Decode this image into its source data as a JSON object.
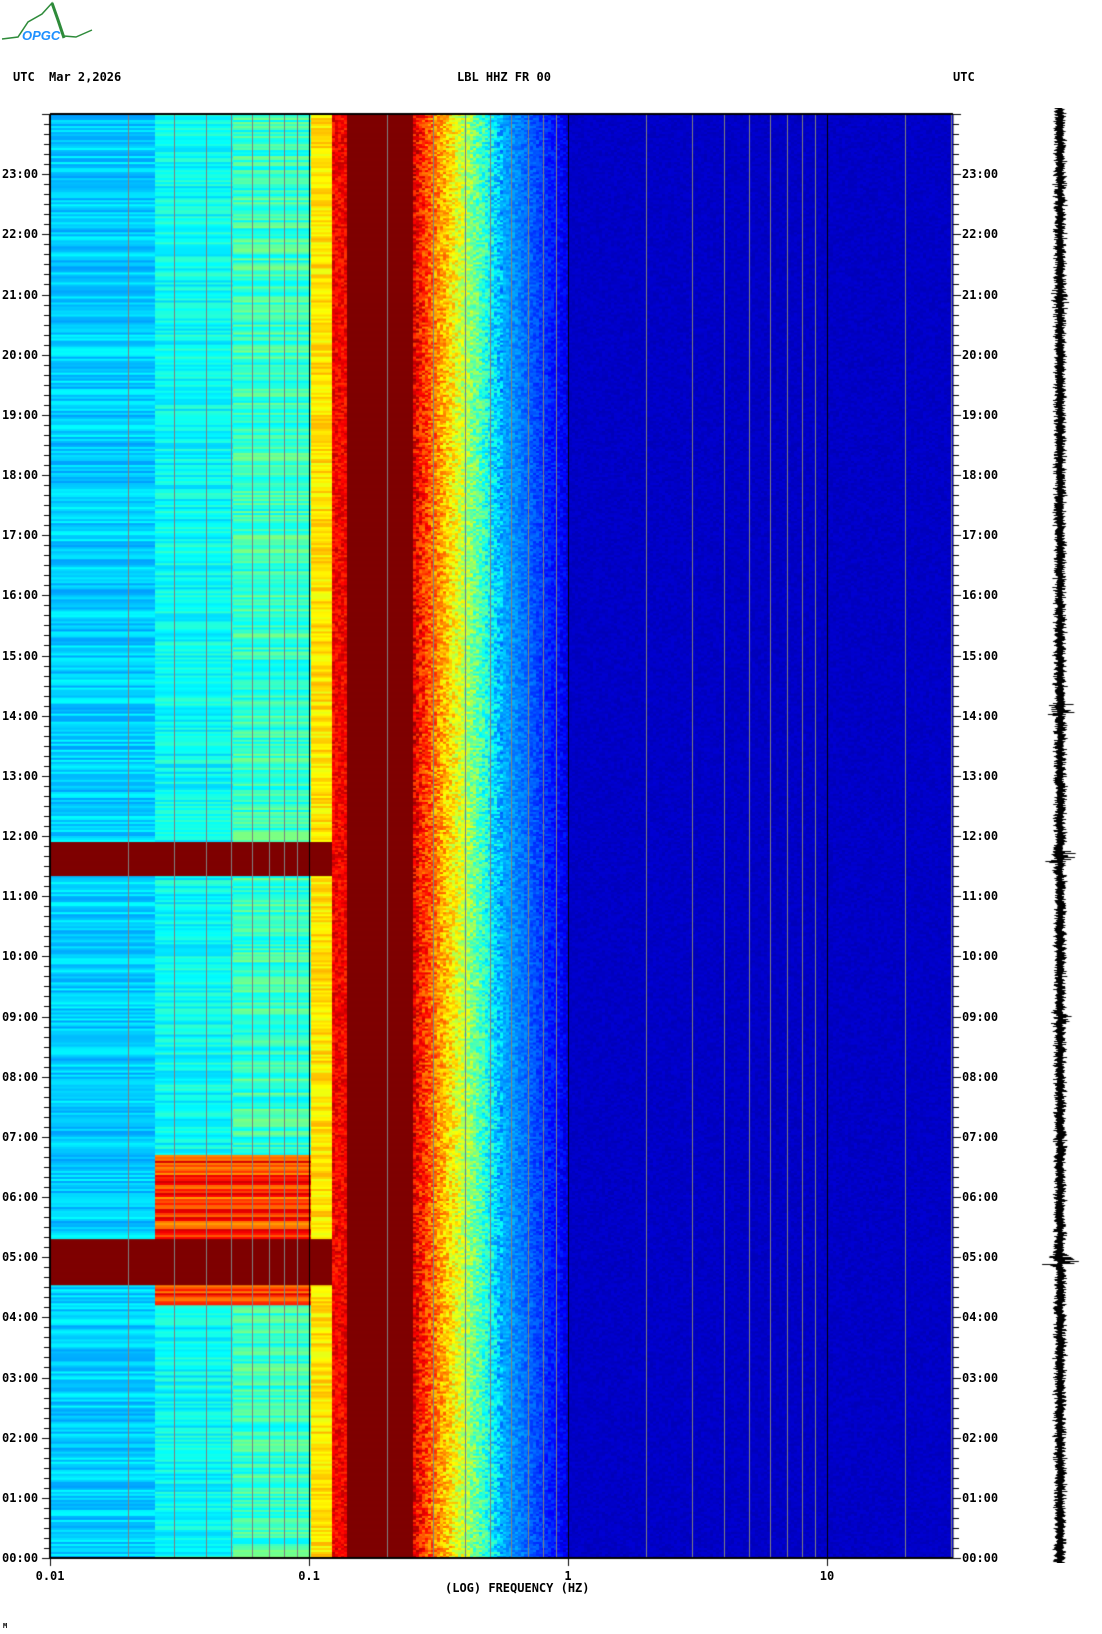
{
  "logo": {
    "text": "OPGC"
  },
  "header": {
    "left_tz": "UTC",
    "date": "Mar 2,2026",
    "title": "LBL HHZ FR 00",
    "right_tz": "UTC"
  },
  "footer_mark": "M",
  "colors": {
    "low": "#000080",
    "background_blue": "#0000a0",
    "peak": "#800000",
    "grid": "#808080"
  },
  "chart_data": {
    "type": "heatmap",
    "title": "LBL HHZ FR 00",
    "xlabel": "(LOG) FREQUENCY (HZ)",
    "ylabel": "UTC",
    "xscale": "log",
    "xlim": [
      0.01,
      30
    ],
    "ylim_hours": [
      0,
      24
    ],
    "x_ticks": [
      "0.01",
      "0.1",
      "1",
      "10"
    ],
    "x_tick_values": [
      0.01,
      0.1,
      1,
      10
    ],
    "y_ticks": [
      "00:00",
      "01:00",
      "02:00",
      "03:00",
      "04:00",
      "05:00",
      "06:00",
      "07:00",
      "08:00",
      "09:00",
      "10:00",
      "11:00",
      "12:00",
      "13:00",
      "14:00",
      "15:00",
      "16:00",
      "17:00",
      "18:00",
      "19:00",
      "20:00",
      "21:00",
      "22:00",
      "23:00"
    ],
    "colormap": "jet",
    "microseism_peak_hz": [
      0.14,
      0.25
    ],
    "events": [
      {
        "start_hour": 11.35,
        "end_hour": 11.9,
        "max_freq_hz": 0.12
      },
      {
        "start_hour": 4.55,
        "end_hour": 5.3,
        "max_freq_hz": 0.12
      },
      {
        "start_hour": 4.2,
        "end_hour": 6.7,
        "max_freq_hz": 0.1
      }
    ]
  }
}
